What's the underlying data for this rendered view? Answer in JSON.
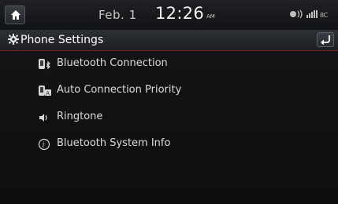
{
  "status_bar": {
    "date": "Feb.  1",
    "time": "12:26",
    "ampm": "AM",
    "indicators": "◉)) ││││ 9C"
  },
  "header": {
    "title": "Phone Settings",
    "title_icon": "gear-icon",
    "back_icon": "back-arrow-icon"
  },
  "menu": {
    "items": [
      {
        "label": "Bluetooth Connection",
        "icon": "bluetooth-phone-icon"
      },
      {
        "label": "Auto Connection Priority",
        "icon": "auto-connection-icon"
      },
      {
        "label": "Ringtone",
        "icon": "speaker-icon"
      },
      {
        "label": "Bluetooth System Info",
        "icon": "info-icon"
      }
    ]
  },
  "colors": {
    "accent_line": "#7a1e1e",
    "background": "#0e0f11"
  }
}
